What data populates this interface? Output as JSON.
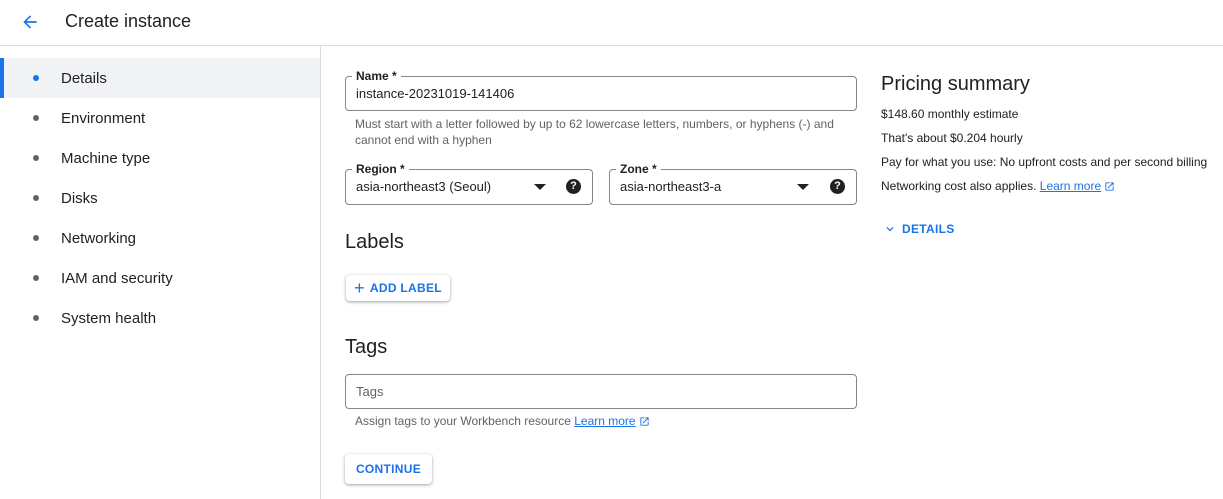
{
  "header": {
    "title": "Create instance"
  },
  "sidebar": {
    "items": [
      {
        "label": "Details"
      },
      {
        "label": "Environment"
      },
      {
        "label": "Machine type"
      },
      {
        "label": "Disks"
      },
      {
        "label": "Networking"
      },
      {
        "label": "IAM and security"
      },
      {
        "label": "System health"
      }
    ],
    "active_index": 0
  },
  "form": {
    "name": {
      "label": "Name *",
      "value": "instance-20231019-141406",
      "hint": "Must start with a letter followed by up to 62 lowercase letters, numbers, or hyphens (-) and cannot end with a hyphen"
    },
    "region": {
      "label": "Region *",
      "value": "asia-northeast3 (Seoul)"
    },
    "zone": {
      "label": "Zone *",
      "value": "asia-northeast3-a"
    },
    "labels": {
      "title": "Labels",
      "add_button": "ADD LABEL"
    },
    "tags": {
      "title": "Tags",
      "placeholder": "Tags",
      "hint": "Assign tags to your Workbench resource",
      "hint_link": "Learn more"
    },
    "continue_button": "CONTINUE"
  },
  "pricing": {
    "title": "Pricing summary",
    "monthly": "$148.60 monthly estimate",
    "hourly": "That's about $0.204 hourly",
    "billing": "Pay for what you use: No upfront costs and per second billing",
    "networking": "Networking cost also applies.",
    "networking_link": "Learn more",
    "details_toggle": "DETAILS"
  },
  "colors": {
    "accent": "#1a73e8",
    "border": "#dadce0",
    "active_bg": "#f1f3f4"
  }
}
